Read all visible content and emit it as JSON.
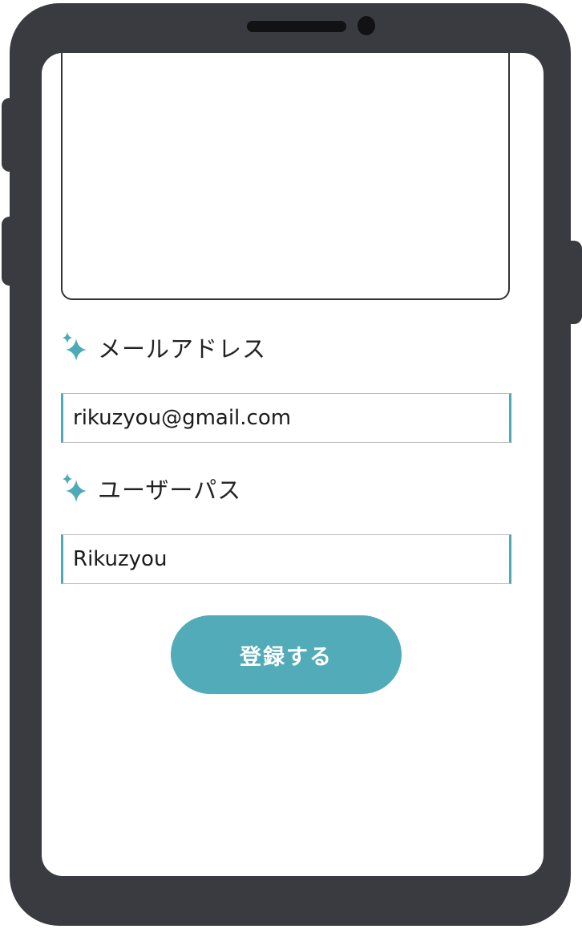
{
  "colors": {
    "accent": "#52abb9",
    "phone_frame": "#3a3b40",
    "sparkle": "#4eaab8"
  },
  "form": {
    "email": {
      "label": "メールアドレス",
      "icon": "sparkle-icon",
      "value": "rikuzyou@gmail.com"
    },
    "password": {
      "label": "ユーザーパス",
      "icon": "sparkle-icon",
      "value": "Rikuzyou"
    },
    "submit_label": "登録する"
  }
}
